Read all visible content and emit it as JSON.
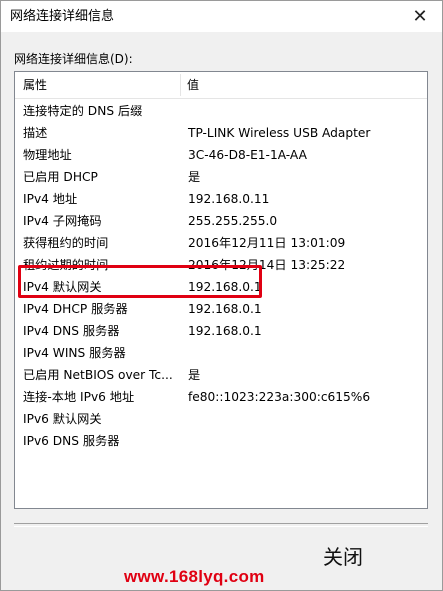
{
  "window": {
    "title": "网络连接详细信息"
  },
  "details": {
    "group_label": "网络连接详细信息(D):",
    "columns": {
      "property": "属性",
      "value": "值"
    },
    "rows": [
      {
        "property": "连接特定的 DNS 后缀",
        "value": ""
      },
      {
        "property": "描述",
        "value": "TP-LINK Wireless USB Adapter"
      },
      {
        "property": "物理地址",
        "value": "3C-46-D8-E1-1A-AA"
      },
      {
        "property": "已启用 DHCP",
        "value": "是"
      },
      {
        "property": "IPv4 地址",
        "value": "192.168.0.11"
      },
      {
        "property": "IPv4 子网掩码",
        "value": "255.255.255.0"
      },
      {
        "property": "获得租约的时间",
        "value": "2016年12月11日 13:01:09"
      },
      {
        "property": "租约过期的时间",
        "value": "2016年12月14日 13:25:22"
      },
      {
        "property": "IPv4 默认网关",
        "value": "192.168.0.1"
      },
      {
        "property": "IPv4 DHCP 服务器",
        "value": "192.168.0.1"
      },
      {
        "property": "IPv4 DNS 服务器",
        "value": "192.168.0.1"
      },
      {
        "property": "IPv4 WINS 服务器",
        "value": ""
      },
      {
        "property": "已启用 NetBIOS over Tc...",
        "value": "是"
      },
      {
        "property": "连接-本地 IPv6 地址",
        "value": "fe80::1023:223a:300:c615%6"
      },
      {
        "property": "IPv6 默认网关",
        "value": ""
      },
      {
        "property": "IPv6 DNS 服务器",
        "value": ""
      }
    ]
  },
  "footer": {
    "close_label": "关闭"
  },
  "watermark": {
    "text": "www.168lyq.com"
  },
  "colors": {
    "highlight": "#e00012",
    "watermark": "#e00012"
  },
  "icons": {
    "close": "close-icon"
  }
}
